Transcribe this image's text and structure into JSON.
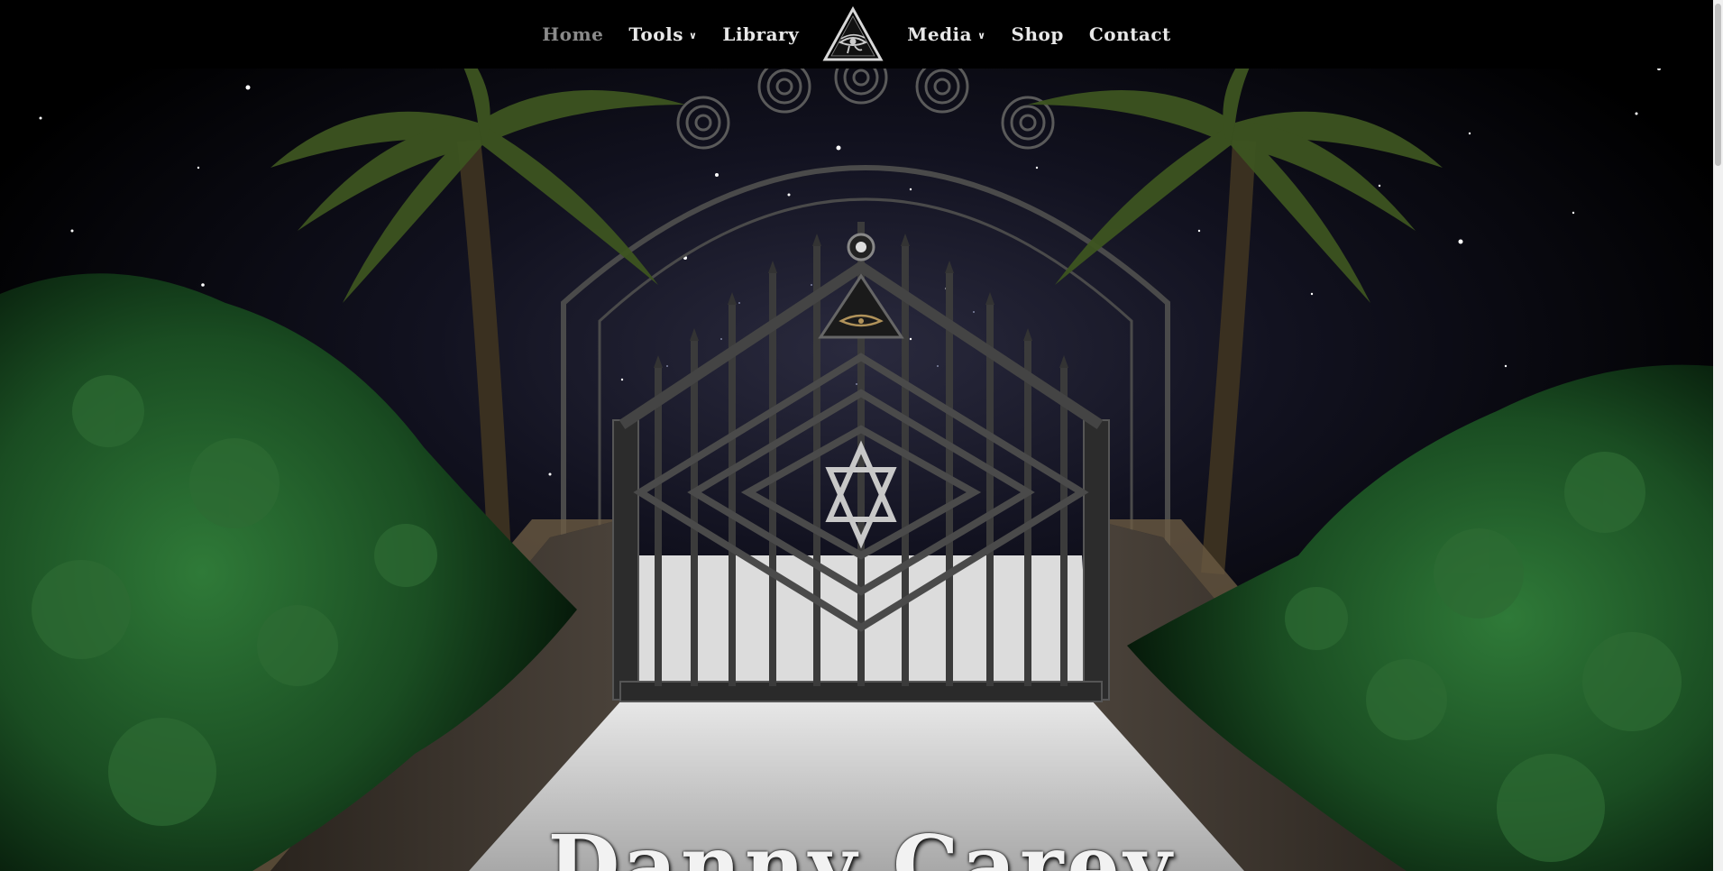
{
  "nav": {
    "left": [
      {
        "label": "Home",
        "active": true,
        "dropdown": false
      },
      {
        "label": "Tools",
        "active": false,
        "dropdown": true
      },
      {
        "label": "Library",
        "active": false,
        "dropdown": false
      }
    ],
    "right": [
      {
        "label": "Media",
        "active": false,
        "dropdown": true
      },
      {
        "label": "Shop",
        "active": false,
        "dropdown": false
      },
      {
        "label": "Contact",
        "active": false,
        "dropdown": false
      }
    ],
    "logo_icon": "eye-of-horus-triangle-icon",
    "chevron_icon": "chevron-down-icon"
  },
  "hero": {
    "title": "Danny Carey",
    "scene_icons": [
      "palm-tree-icon",
      "iron-gate-icon",
      "unicursal-hexagram-icon",
      "eye-of-horus-icon",
      "spiral-icon"
    ]
  },
  "colors": {
    "nav_bg": "#000000",
    "nav_text": "#e8e8e8",
    "nav_active": "#8a8a8a",
    "foliage": "#1f5a26",
    "gate_metal": "#3a3a3a",
    "path_stone": "#bdbdbd"
  }
}
